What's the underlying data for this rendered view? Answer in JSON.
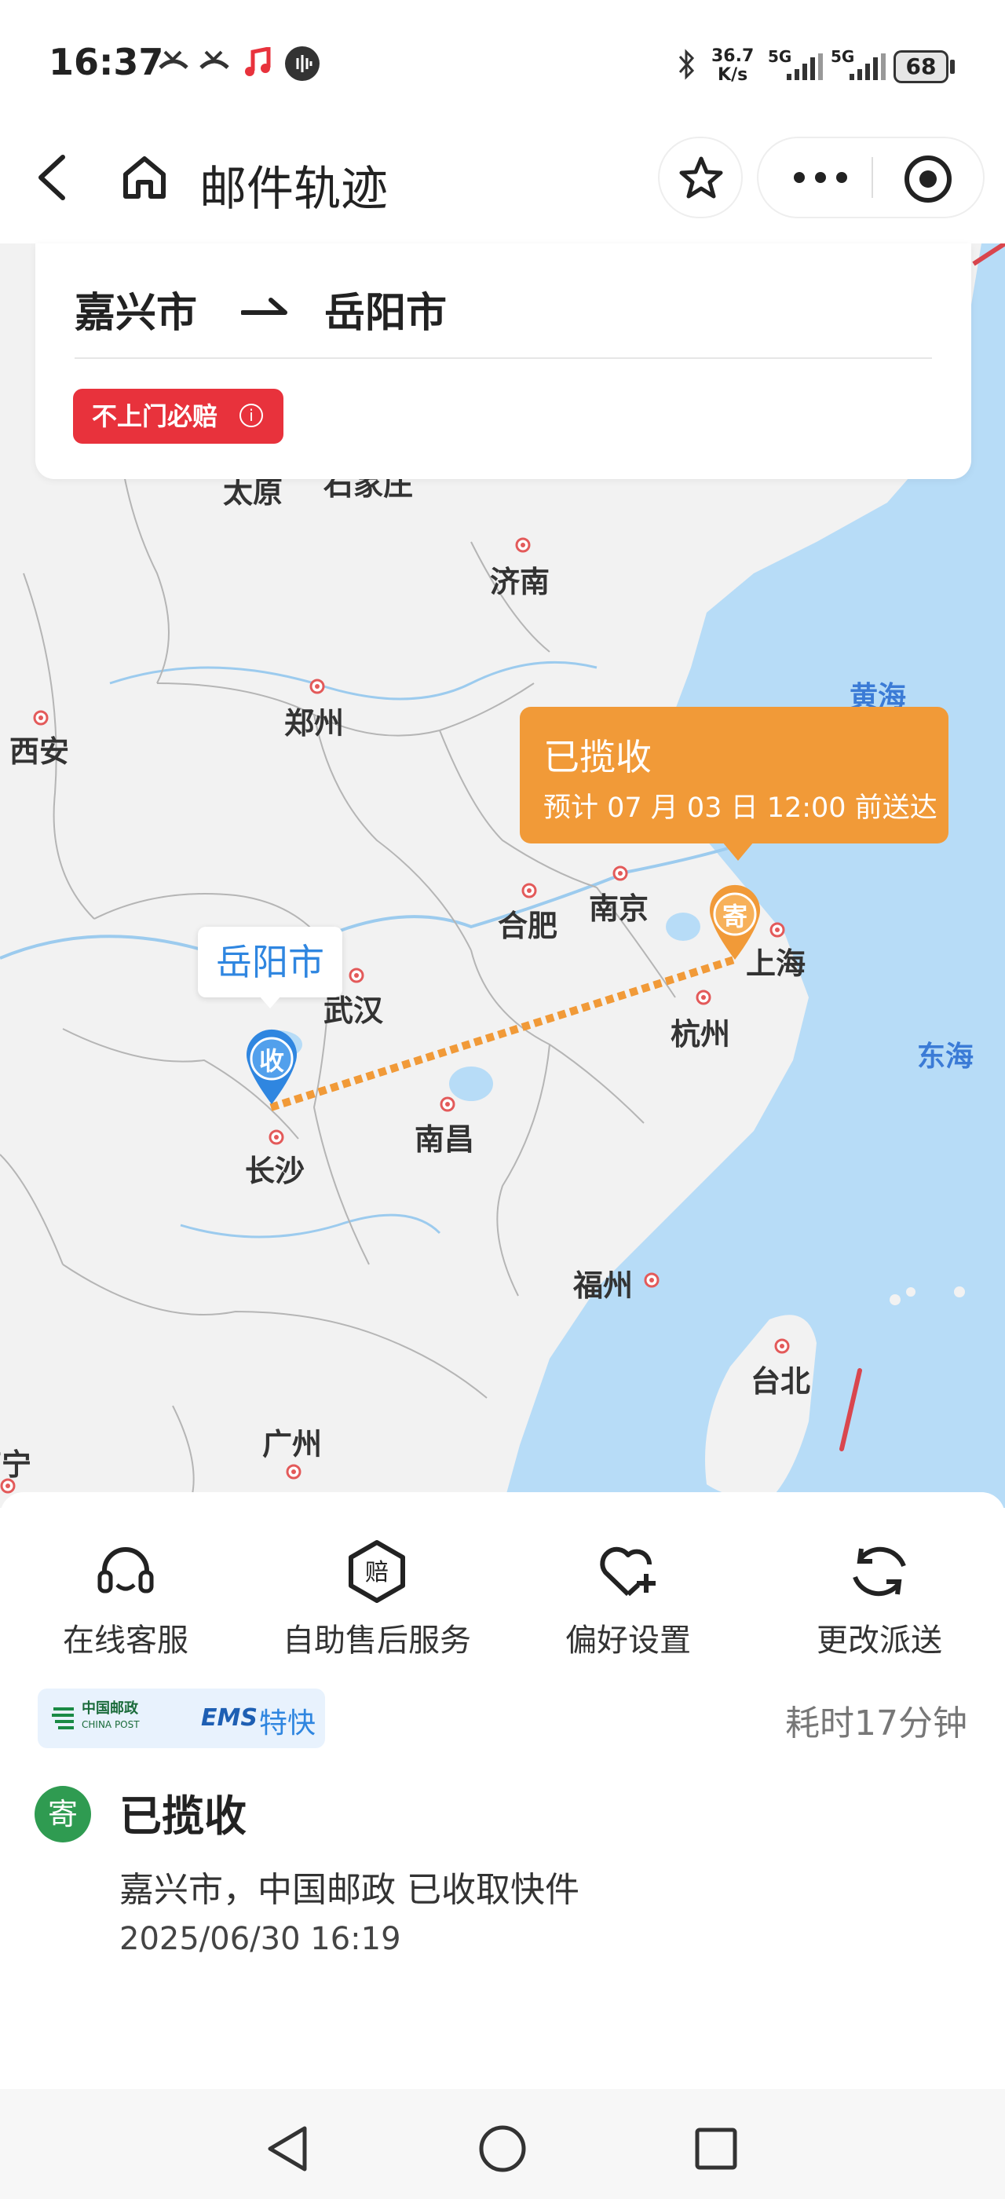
{
  "status_bar": {
    "time": "16:37",
    "net_speed_top": "36.7",
    "net_speed_bottom": "K/s",
    "signal_1": "5G",
    "signal_2": "5G",
    "battery": "68"
  },
  "nav": {
    "title": "邮件轨迹"
  },
  "route": {
    "origin": "嘉兴市",
    "arrow": "⇀",
    "destination": "岳阳市",
    "badge": "不上门必赔"
  },
  "map": {
    "cities": {
      "taiyuan": "太原",
      "shijiazhuang": "石家庄",
      "jinan": "济南",
      "zhengzhou": "郑州",
      "xian": "西安",
      "hefei": "合肥",
      "nanjing": "南京",
      "wuhan": "武汉",
      "shanghai": "上海",
      "hangzhou": "杭州",
      "changsha": "长沙",
      "nanchang": "南昌",
      "fuzhou": "福州",
      "taipei": "台北",
      "guangzhou": "广州",
      "nanning": "南宁"
    },
    "seas": {
      "yellow_sea": "黄海",
      "east_sea": "东海"
    },
    "bubble_title": "已揽收",
    "bubble_eta": "预计 07 月 03 日 12:00 前送达",
    "destination_label": "岳阳市",
    "send_marker": "寄",
    "receive_marker": "收",
    "colors": {
      "land": "#f2f2f2",
      "sea": "#b7dcf7",
      "route": "#f19a38",
      "accent": "#2f86e0"
    }
  },
  "actions": [
    {
      "label": "在线客服",
      "icon": "headset-icon"
    },
    {
      "label": "自助售后服务",
      "icon": "compensation-icon"
    },
    {
      "label": "偏好设置",
      "icon": "heart-plus-icon"
    },
    {
      "label": "更改派送",
      "icon": "refresh-icon"
    }
  ],
  "carrier": {
    "name_cn": "中国邮政",
    "name_en": "CHINA POST",
    "ems": "EMS",
    "service": "特快",
    "elapsed": "耗时17分钟"
  },
  "event": {
    "dot_label": "寄",
    "title": "已揽收",
    "description": "嘉兴市，中国邮政 已收取快件",
    "time": "2025/06/30 16:19"
  }
}
